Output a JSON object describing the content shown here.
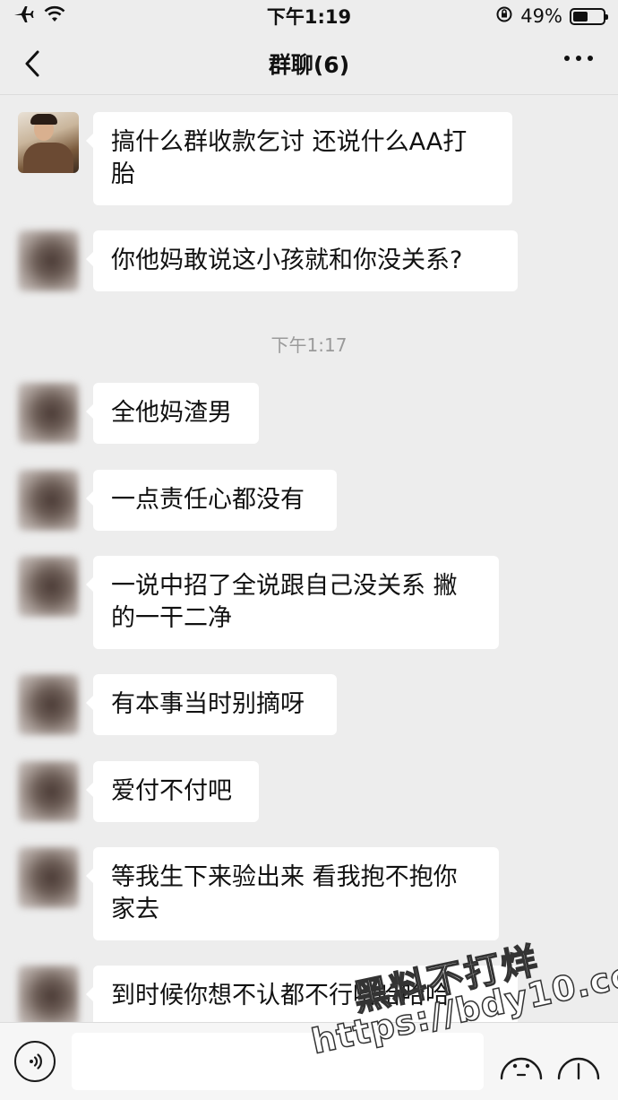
{
  "status_bar": {
    "time": "下午1:19",
    "battery_percent": "49%",
    "battery_level": 0.49
  },
  "nav": {
    "title": "群聊(6)",
    "back_icon": "chevron-left-icon",
    "more_icon": "more-dots-icon"
  },
  "messages": [
    {
      "text": "搞什么群收款乞讨  还说什么AA打\n胎",
      "avatar": "photo"
    },
    {
      "text": "你他妈敢说这小孩就和你没关系?",
      "avatar": "blurred"
    },
    {
      "text": "全他妈渣男",
      "avatar": "blurred"
    },
    {
      "text": "一点责任心都没有",
      "avatar": "blurred"
    },
    {
      "text": "一说中招了全说跟自己没关系 撇\n的一干二净",
      "avatar": "blurred"
    },
    {
      "text": "有本事当时别摘呀",
      "avatar": "blurred"
    },
    {
      "text": "爱付不付吧",
      "avatar": "blurred"
    },
    {
      "text": "等我生下来验出来 看我抱不抱你\n家去",
      "avatar": "blurred"
    },
    {
      "text": "到时候你想不认都不行哈哈哈哈",
      "avatar": "blurred"
    }
  ],
  "timestamp": "下午1:17",
  "input_bar": {
    "placeholder": "",
    "voice_icon": "voice-icon",
    "emoji_icon": "emoji-icon",
    "plus_icon": "plus-icon"
  },
  "watermark": {
    "line1": "黑料不打烊",
    "line2": "https://bdy10.co"
  }
}
